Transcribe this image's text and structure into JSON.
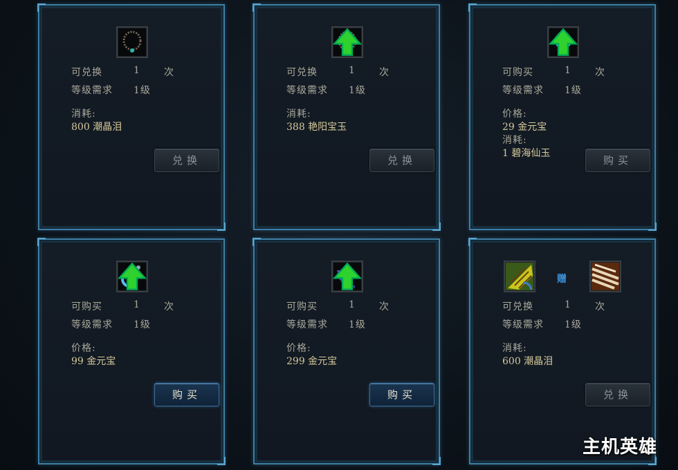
{
  "labels": {
    "exchangeable": "可兑换",
    "buyable": "可购买",
    "level_req": "等级需求",
    "cost": "消耗:",
    "price": "价格:",
    "times_unit": "次",
    "gift": "赠"
  },
  "cards": [
    {
      "limit_label": "可兑换",
      "count": "1",
      "unit": "次",
      "level": "1级",
      "cost_header": "消耗:",
      "cost_value": "800 潮晶泪",
      "button": "兑换",
      "button_active": false,
      "icon": "necklace-icon",
      "upgrade": false
    },
    {
      "limit_label": "可兑换",
      "count": "1",
      "unit": "次",
      "level": "1级",
      "cost_header": "消耗:",
      "cost_value": "388 艳阳宝玉",
      "button": "兑换",
      "button_active": false,
      "icon": "necklace-icon",
      "upgrade": true
    },
    {
      "limit_label": "可购买",
      "count": "1",
      "unit": "次",
      "level": "1级",
      "price_header": "价格:",
      "price_value": "29 金元宝",
      "cost_header": "消耗:",
      "cost_value": "1 碧海仙玉",
      "button": "购买",
      "button_active": false,
      "icon": "pearl-necklace-icon",
      "upgrade": true
    },
    {
      "limit_label": "可购买",
      "count": "1",
      "unit": "次",
      "level": "1级",
      "price_header": "价格:",
      "price_value": "99 金元宝",
      "button": "购买",
      "button_active": true,
      "icon": "ring-icon",
      "upgrade": true
    },
    {
      "limit_label": "可购买",
      "count": "1",
      "unit": "次",
      "level": "1级",
      "price_header": "价格:",
      "price_value": "299 金元宝",
      "button": "购买",
      "button_active": true,
      "icon": "bead-chain-icon",
      "upgrade": true
    },
    {
      "limit_label": "可兑换",
      "count": "1",
      "unit": "次",
      "level": "1级",
      "cost_header": "消耗:",
      "cost_value": "600 潮晶泪",
      "button": "兑换",
      "button_active": false,
      "icon": "fan-icon",
      "gift_icon": "scroll-icon",
      "gift_word": "赠",
      "upgrade": false
    }
  ],
  "watermark": "主机英雄",
  "colors": {
    "border": "#3f7fa6",
    "label": "#a9a89a",
    "value": "#d5c99a",
    "upgrade_arrow": "#2fd12f"
  }
}
